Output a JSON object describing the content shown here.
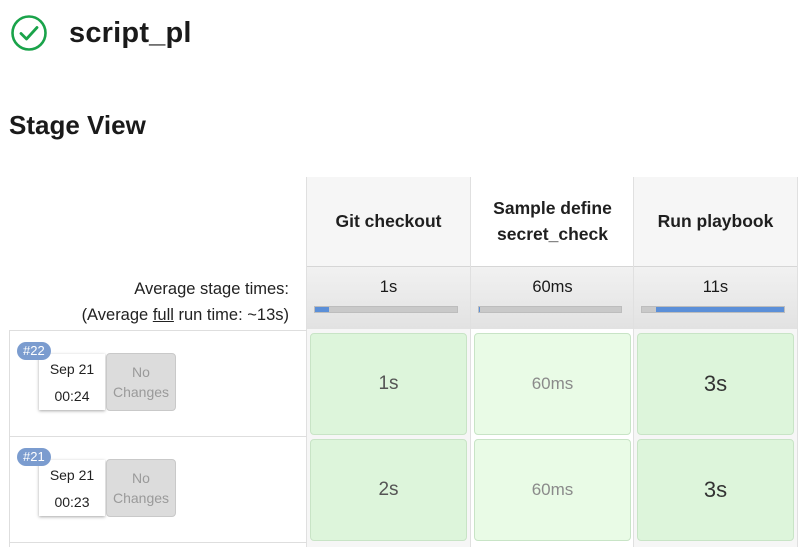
{
  "job": {
    "title": "script_pl",
    "status_icon": "check-circle-icon",
    "status_color": "#1aa34a"
  },
  "section_title": "Stage View",
  "average": {
    "label_line1": "Average stage times:",
    "label_prefix": "(Average ",
    "label_full": "full",
    "label_suffix": " run time: ~13s)"
  },
  "stages": [
    {
      "name": "Git checkout",
      "avg_time": "1s",
      "avg_progress": 0.1
    },
    {
      "name": "Sample define secret_check",
      "avg_time": "60ms",
      "avg_progress": 0.01
    },
    {
      "name": "Run playbook",
      "avg_time": "11s",
      "avg_progress": 0.9
    }
  ],
  "builds": [
    {
      "number": "#22",
      "date": "Sep 21",
      "time": "00:24",
      "changes": "No Changes",
      "stage_times": [
        "1s",
        "60ms",
        "3s"
      ]
    },
    {
      "number": "#21",
      "date": "Sep 21",
      "time": "00:23",
      "changes": "No Changes",
      "stage_times": [
        "2s",
        "60ms",
        "3s"
      ]
    }
  ],
  "colors": {
    "success_cell": "#ddf5db",
    "success_cell_light": "#e9fbe6",
    "badge": "#7b9ccf",
    "progress": "#5b8fd8"
  }
}
